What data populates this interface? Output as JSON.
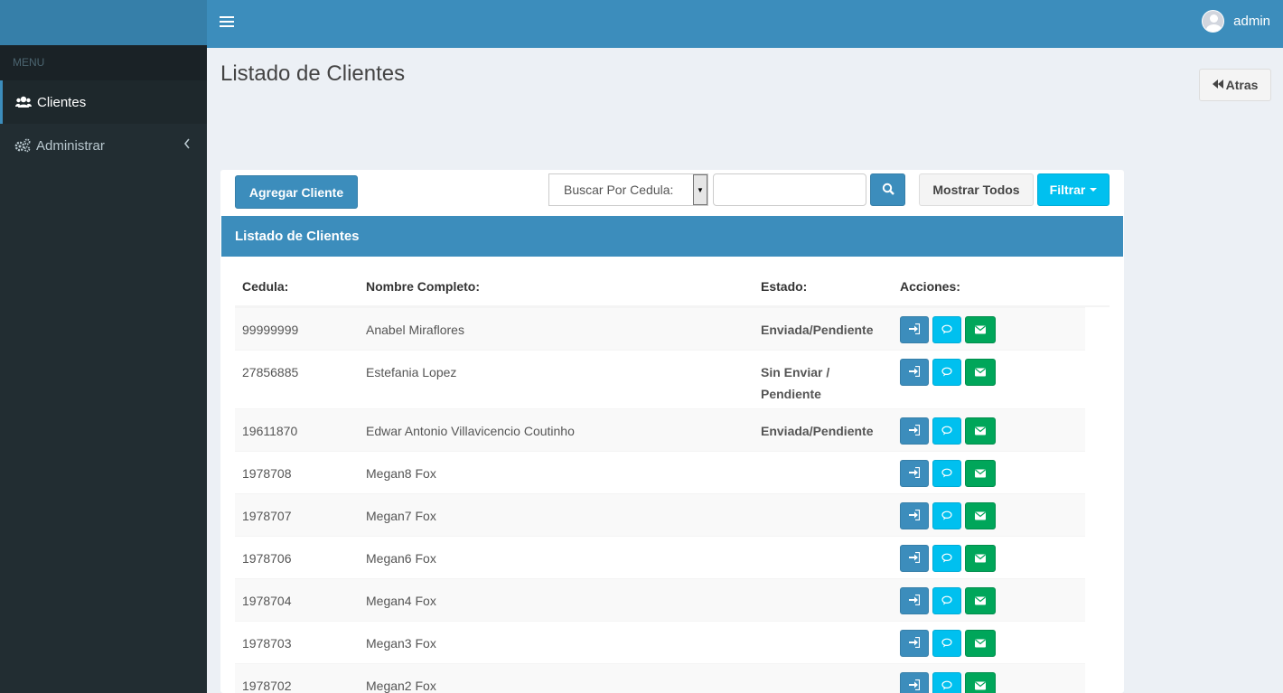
{
  "sidebar": {
    "menu_header": "MENU",
    "items": [
      {
        "label": "Clientes"
      },
      {
        "label": "Administrar"
      }
    ]
  },
  "navbar": {
    "user": "admin"
  },
  "page": {
    "title": "Listado de Clientes",
    "back_label": "Atras"
  },
  "toolbar": {
    "add_label": "Agregar Cliente",
    "search_select": "Buscar Por Cedula:",
    "search_value": "",
    "show_all_label": "Mostrar Todos",
    "filter_label": "Filtrar"
  },
  "panel": {
    "title": "Listado de Clientes"
  },
  "table": {
    "headers": [
      "Cedula:",
      "Nombre Completo:",
      "Estado:",
      "Acciones:"
    ],
    "rows": [
      {
        "cedula": "99999999",
        "nombre": "Anabel Miraflores",
        "estado": "Enviada/Pendiente"
      },
      {
        "cedula": "27856885",
        "nombre": "Estefania Lopez",
        "estado": "Sin Enviar / Pendiente"
      },
      {
        "cedula": "19611870",
        "nombre": "Edwar Antonio Villavicencio Coutinho",
        "estado": "Enviada/Pendiente"
      },
      {
        "cedula": "1978708",
        "nombre": "Megan8 Fox",
        "estado": ""
      },
      {
        "cedula": "1978707",
        "nombre": "Megan7 Fox",
        "estado": ""
      },
      {
        "cedula": "1978706",
        "nombre": "Megan6 Fox",
        "estado": ""
      },
      {
        "cedula": "1978704",
        "nombre": "Megan4 Fox",
        "estado": ""
      },
      {
        "cedula": "1978703",
        "nombre": "Megan3 Fox",
        "estado": ""
      },
      {
        "cedula": "1978702",
        "nombre": "Megan2 Fox",
        "estado": ""
      }
    ]
  },
  "icons": {
    "hamburger": "bars-icon",
    "users": "users-icon",
    "admin": "cogs-icon",
    "chevron": "chevron-left-icon",
    "back": "backward-icon",
    "search": "search-icon",
    "login": "sign-in-icon",
    "comment": "comment-icon",
    "mail": "envelope-icon"
  },
  "colors": {
    "primary": "#3c8dbc",
    "info": "#00c0ef",
    "success": "#00a65a",
    "sidebar": "#222d32",
    "estado_enviada": "#1a22c9",
    "estado_sin_enviar": "#8e1ec9"
  }
}
